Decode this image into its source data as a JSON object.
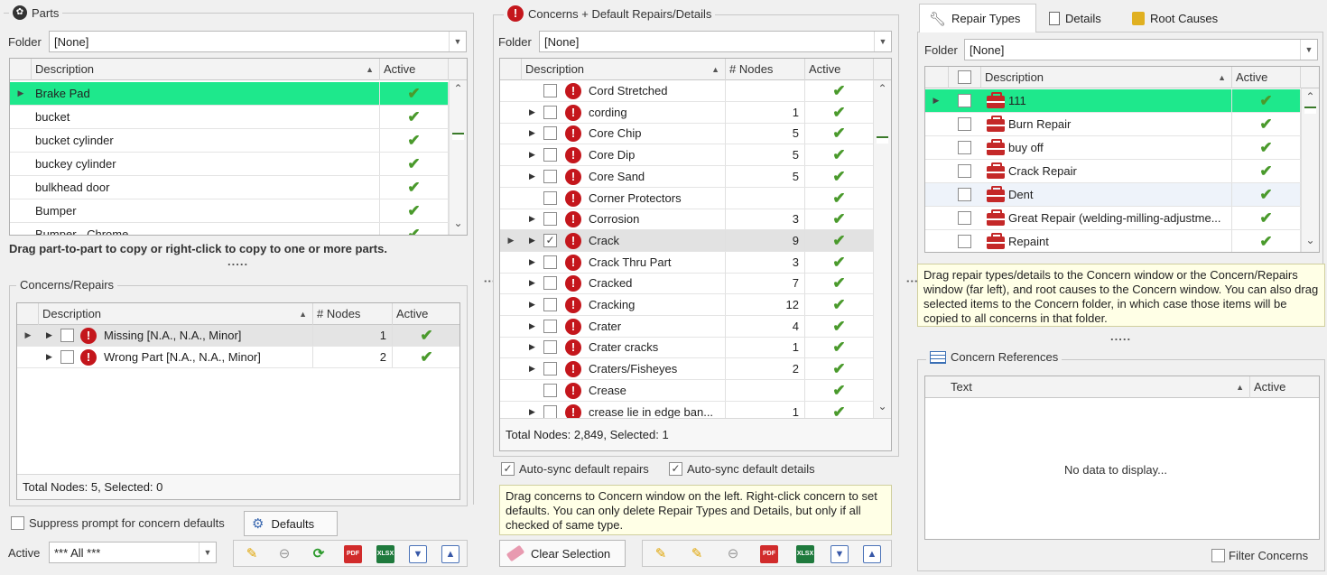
{
  "parts": {
    "title": "Parts",
    "folder_label": "Folder",
    "folder_value": "[None]",
    "col_description": "Description",
    "col_active": "Active",
    "rows": [
      "Brake Pad",
      "bucket",
      "bucket cylinder",
      "buckey cylinder",
      "bulkhead door",
      "Bumper",
      "Bumper - Chrome"
    ],
    "hint": "Drag part-to-part to copy or right-click to copy to one or more parts.",
    "dots": "....."
  },
  "concerns_repairs": {
    "title": "Concerns/Repairs",
    "col_description": "Description",
    "col_nodes": "# Nodes",
    "col_active": "Active",
    "rows": [
      {
        "desc": "Missing [N.A., N.A., Minor]",
        "nodes": "1"
      },
      {
        "desc": "Wrong Part [N.A., N.A., Minor]",
        "nodes": "2"
      }
    ],
    "footer": "Total Nodes: 5, Selected: 0",
    "suppress_label": "Suppress prompt for concern defaults",
    "defaults_button": "Defaults",
    "active_label": "Active",
    "active_value": "*** All ***"
  },
  "concerns": {
    "title": "Concerns + Default Repairs/Details",
    "folder_label": "Folder",
    "folder_value": "[None]",
    "col_description": "Description",
    "col_nodes": "# Nodes",
    "col_active": "Active",
    "rows": [
      {
        "desc": "Cord Stretched",
        "nodes": "",
        "exp": false,
        "checked": false
      },
      {
        "desc": "cording",
        "nodes": "1",
        "exp": true,
        "checked": false
      },
      {
        "desc": "Core Chip",
        "nodes": "5",
        "exp": true,
        "checked": false
      },
      {
        "desc": "Core Dip",
        "nodes": "5",
        "exp": true,
        "checked": false
      },
      {
        "desc": "Core Sand",
        "nodes": "5",
        "exp": true,
        "checked": false
      },
      {
        "desc": "Corner Protectors",
        "nodes": "",
        "exp": false,
        "checked": false
      },
      {
        "desc": "Corrosion",
        "nodes": "3",
        "exp": true,
        "checked": false
      },
      {
        "desc": "Crack",
        "nodes": "9",
        "exp": true,
        "checked": true
      },
      {
        "desc": "Crack Thru Part",
        "nodes": "3",
        "exp": true,
        "checked": false
      },
      {
        "desc": "Cracked",
        "nodes": "7",
        "exp": true,
        "checked": false
      },
      {
        "desc": "Cracking",
        "nodes": "12",
        "exp": true,
        "checked": false
      },
      {
        "desc": "Crater",
        "nodes": "4",
        "exp": true,
        "checked": false
      },
      {
        "desc": "Crater cracks",
        "nodes": "1",
        "exp": true,
        "checked": false
      },
      {
        "desc": "Craters/Fisheyes",
        "nodes": "2",
        "exp": true,
        "checked": false
      },
      {
        "desc": "Crease",
        "nodes": "",
        "exp": false,
        "checked": false
      },
      {
        "desc": "crease lie in edge ban...",
        "nodes": "1",
        "exp": true,
        "checked": false
      }
    ],
    "footer": "Total Nodes: 2,849, Selected: 1",
    "auto_sync_repairs": "Auto-sync default repairs",
    "auto_sync_details": "Auto-sync default details",
    "hint": "Drag concerns to Concern window on the left. Right-click concern to set defaults. You can only delete Repair Types and Details, but only if all checked of same type.",
    "clear_selection": "Clear Selection"
  },
  "repair": {
    "tabs": [
      "Repair Types",
      "Details",
      "Root Causes"
    ],
    "folder_label": "Folder",
    "folder_value": "[None]",
    "col_description": "Description",
    "col_active": "Active",
    "rows": [
      "111",
      "Burn Repair",
      "buy off",
      "Crack Repair",
      "Dent",
      "Great Repair (welding-milling-adjustme...",
      "Repaint"
    ],
    "hint": "Drag repair types/details to the Concern window or the Concern/Repairs window (far left), and root causes to the Concern window. You can also drag selected items to the Concern folder, in which case those items will be copied to all concerns in that folder.",
    "dots": "....."
  },
  "references": {
    "title": "Concern References",
    "col_text": "Text",
    "col_active": "Active",
    "empty": "No data to display...",
    "filter_label": "Filter Concerns"
  },
  "icons": {
    "active_check": "✔",
    "pdf": "PDF",
    "xlsx": "XLSX"
  },
  "colors": {
    "selected_row": "#1ee88c",
    "error_red": "#c4161c",
    "check_green": "#4a9a2c"
  }
}
